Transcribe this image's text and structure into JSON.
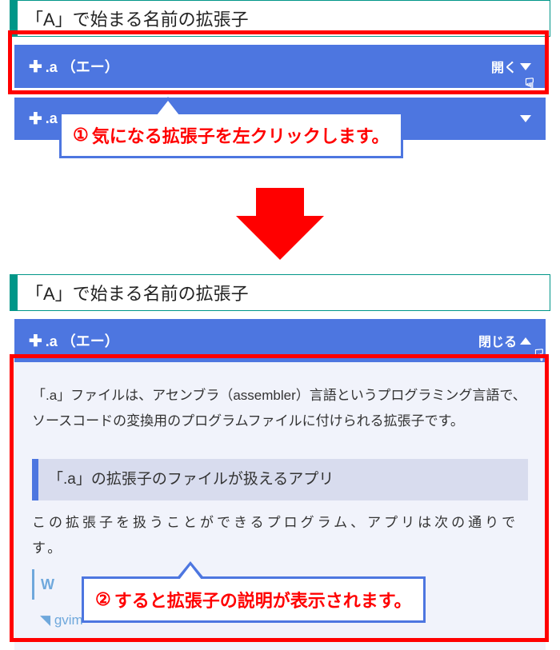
{
  "panel1": {
    "heading": "「A」で始まる名前の拡張子",
    "item": {
      "label": ".a （エー）",
      "action": "開く"
    },
    "callout_num": "①",
    "callout_text": "気になる拡張子を左クリックします。"
  },
  "panel2": {
    "heading": "「A」で始まる名前の拡張子",
    "item": {
      "label": ".a （エー）",
      "action": "閉じる"
    },
    "body_text": "「.a」ファイルは、アセンブラ（assembler）言語というプログラミング言語で、ソースコードの変換用のプログラムファイルに付けられる拡張子です。",
    "sub_heading": "「.a」の拡張子のファイルが扱えるアプリ",
    "sub_text": "この拡張子を扱うことができるプログラム、アプリは次の通りです。",
    "app_group": "W",
    "app_item": "gvim",
    "callout_num": "②",
    "callout_text": "すると拡張子の説明が表示されます。"
  }
}
